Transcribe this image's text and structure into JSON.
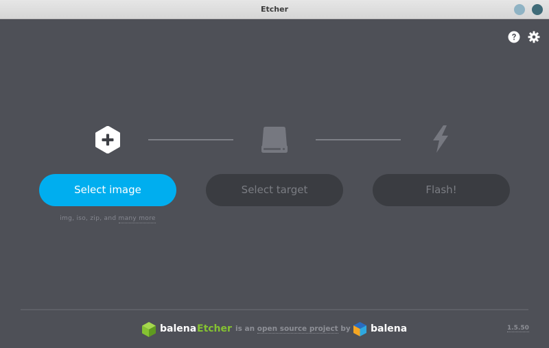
{
  "window": {
    "title": "Etcher"
  },
  "top_actions": {
    "help_icon": "question-circle-icon",
    "settings_icon": "gear-icon"
  },
  "steps": {
    "image": {
      "icon": "plus-hexagon-icon",
      "button_label": "Select image"
    },
    "target": {
      "icon": "drive-icon",
      "button_label": "Select target"
    },
    "flash": {
      "icon": "lightning-bolt-icon",
      "button_label": "Flash!"
    }
  },
  "formats": {
    "list": "img, iso, zip, and",
    "more_link": "many more"
  },
  "footer": {
    "brand_prefix": "balena",
    "brand_suffix": "Etcher",
    "tagline_pre": "is an",
    "tagline_link": "open source project",
    "tagline_post": "by",
    "company": "balena",
    "version": "1.5.50"
  },
  "colors": {
    "background": "#4e5057",
    "accent": "#00aeef",
    "disabled_button": "#3a3c41",
    "etcher_green": "#85c232"
  }
}
